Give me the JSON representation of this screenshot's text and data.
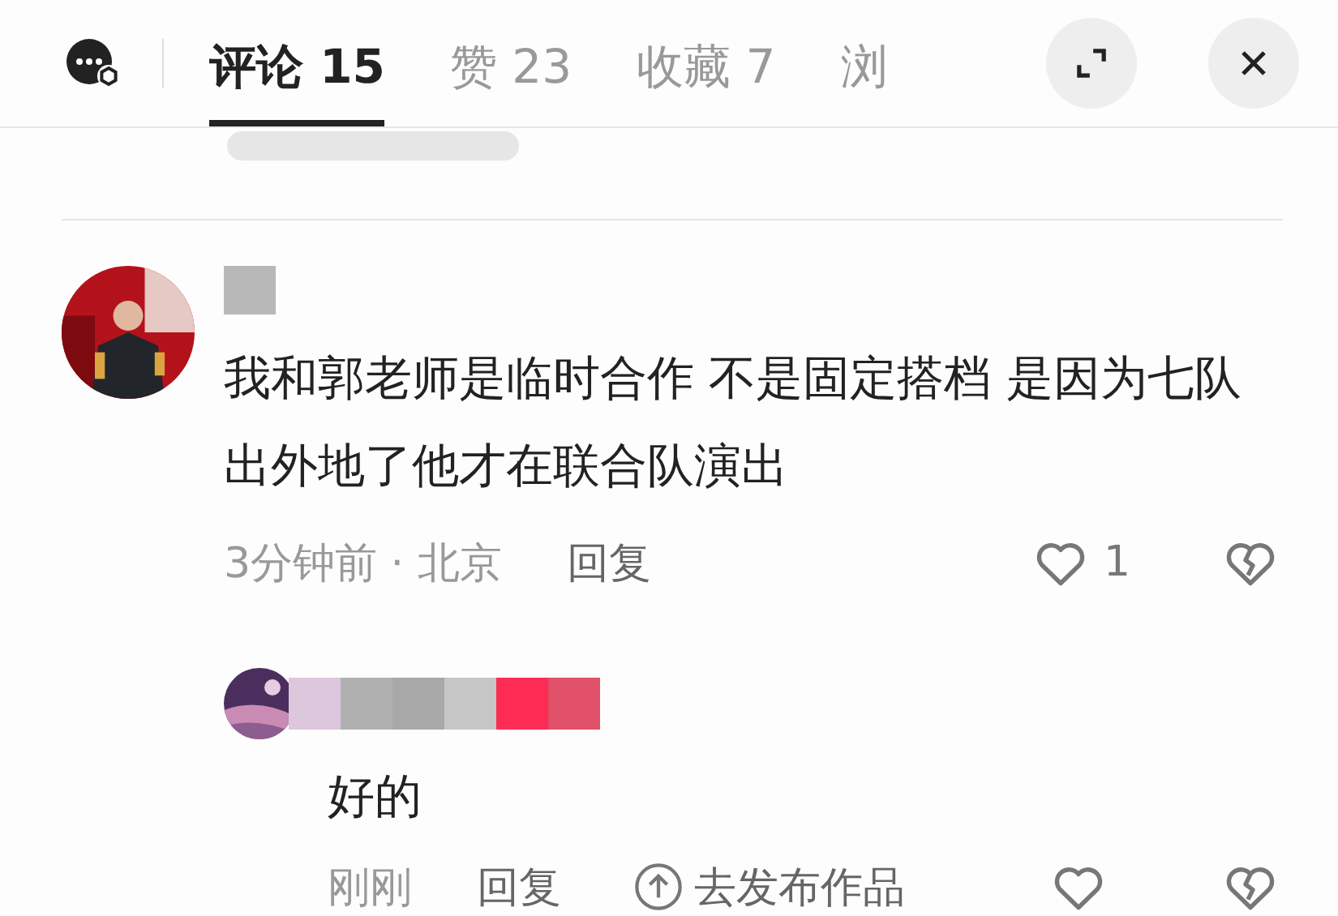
{
  "tabs": [
    {
      "label": "评论 15",
      "selected": true
    },
    {
      "label": "赞 23",
      "selected": false
    },
    {
      "label": "收藏 7",
      "selected": false
    },
    {
      "label": "浏",
      "selected": false
    }
  ],
  "comments": [
    {
      "text": "我和郭老师是临时合作 不是固定搭档 是因为七队出外地了他才在联合队演出",
      "time": "3分钟前 · 北京",
      "reply": "回复",
      "likes": "1",
      "liked": false,
      "disliked": false,
      "replies": [
        {
          "text": "好的",
          "time": "刚刚",
          "reply": "回复",
          "publish": "去发布作品",
          "liked": false,
          "disliked": false
        }
      ]
    }
  ]
}
